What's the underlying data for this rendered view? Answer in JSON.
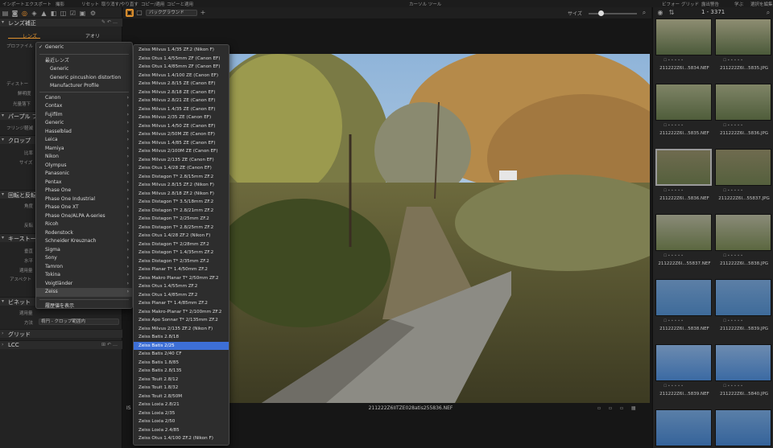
{
  "top_menu": [
    "インポート",
    "エクスポート",
    "撮影",
    "リセット",
    "取り消す/やり直す",
    "コピー/適用",
    "コピーと適用",
    "カーソル ツール",
    "ビフォー",
    "グリッド",
    "露出警告",
    "学ぶ",
    "選択を編集"
  ],
  "left_panel": {
    "lens_section_title": "レンズ補正",
    "tabs": [
      "レンズ",
      "アオリ"
    ],
    "rows": [
      "プロファイル",
      "ディストー",
      "鮮明度",
      "光量落下"
    ],
    "purple_section": "パープル フ",
    "fringe_row": "フリンジ軽減",
    "crop_section": "クロップ",
    "crop_rows": [
      "比率",
      "サイズ"
    ],
    "rotate_section": "回転と反転",
    "rotate_rows": [
      "角度",
      "反転"
    ],
    "keystone_section": "キーストー",
    "keystone_rows": [
      "垂直",
      "水平",
      "適用量",
      "アスペクト"
    ],
    "vignette_section": "ビネット",
    "vignette_rows": [
      "適用量",
      "方法"
    ],
    "vignette_method_value": "楕円 - クロップ範囲内",
    "grid_section": "グリッド",
    "lcc_section": "LCC"
  },
  "viewer": {
    "background_select": "バックグラウンド",
    "size_label": "サイズ",
    "filename": "211222Z6IITZE028atis255836.NEF",
    "left_fragment": "IS"
  },
  "browser": {
    "counter": "1 - 3371",
    "thumbnails": [
      {
        "name": "211222Z6I...5834.NEF"
      },
      {
        "name": "211222Z6I...5835.JPG"
      },
      {
        "name": "211222Z6I...5835.NEF"
      },
      {
        "name": "211222Z6I...5836.JPG"
      },
      {
        "name": "211222Z6I...5836.NEF"
      },
      {
        "name": "211222Z6I...55837.JPG"
      },
      {
        "name": "211222Z6I...55837.NEF"
      },
      {
        "name": "211222Z6I...5838.JPG"
      },
      {
        "name": "211222Z6I...5838.NEF"
      },
      {
        "name": "211222Z6I...5839.JPG"
      },
      {
        "name": "211222Z6I...5839.NEF"
      },
      {
        "name": "211222Z6I...5840.JPG"
      },
      {
        "name": ""
      },
      {
        "name": ""
      }
    ]
  },
  "menu1": {
    "checked": "Generic",
    "recent_header": "最近レンズ",
    "recent": [
      "Generic",
      "Generic pincushion distortion",
      "Manufacturer Profile"
    ],
    "brands": [
      "Canon",
      "Contax",
      "Fujifilm",
      "Generic",
      "Hasselblad",
      "Leica",
      "Mamiya",
      "Nikon",
      "Olympus",
      "Panasonic",
      "Pentax",
      "Phase One",
      "Phase One Industrial",
      "Phase One XT",
      "Phase One/ALPA A-series",
      "Ricoh",
      "Rodenstock",
      "Schneider Kreuznach",
      "Sigma",
      "Sony",
      "Tamron",
      "Tokina",
      "Voigtländer",
      "Zeiss"
    ],
    "highlighted": "Zeiss",
    "footer": "履歴値を表示"
  },
  "menu2": {
    "items": [
      "Zeiss Milvus 1.4/35 ZF.2 (Nikon F)",
      "Zeiss Otus 1.4/55mm ZF (Canon EF)",
      "Zeiss Otus 1.4/85mm ZF (Canon EF)",
      "Zeiss Milvus 1.4/100 ZE (Canon EF)",
      "Zeiss Milvus 2.8/15 ZE (Canon EF)",
      "Zeiss Milvus 2.8/18 ZE (Canon EF)",
      "Zeiss Milvus 2.8/21 ZE (Canon EF)",
      "Zeiss Milvus 1.4/35 ZE (Canon EF)",
      "Zeiss Milvus 2/35 ZE (Canon EF)",
      "Zeiss Milvus 1.4/50 ZE (Canon EF)",
      "Zeiss Milvus 2/50M ZE (Canon EF)",
      "Zeiss Milvus 1.4/85 ZE (Canon EF)",
      "Zeiss Milvus 2/100M ZE (Canon EF)",
      "Zeiss Milvus 2/135 ZE (Canon EF)",
      "Zeiss Otus 1.4/28 ZE (Canon EF)",
      "Zeiss Distagon T* 2.8/15mm ZF.2",
      "Zeiss Milvus 2.8/15 ZF.2 (Nikon F)",
      "Zeiss Milvus 2.8/18 ZF.2 (Nikon F)",
      "Zeiss Distagon T* 3.5/18mm ZF.2",
      "Zeiss Distagon T* 2.8/21mm ZF.2",
      "Zeiss Distagon T* 2/25mm ZF.2",
      "Zeiss Distagon T* 2.8/25mm ZF.2",
      "Zeiss Otus 1.4/28 ZF.2 (Nikon F)",
      "Zeiss Distagon T* 2/28mm ZF.2",
      "Zeiss Distagon T* 1.4/35mm ZF.2",
      "Zeiss Distagon T* 2/35mm ZF.2",
      "Zeiss Planar T* 1.4/50mm ZF.2",
      "Zeiss Makro Planar T* 2/50mm ZF.2",
      "Zeiss Otus 1.4/55mm ZF.2",
      "Zeiss Otus 1.4/85mm ZF.2",
      "Zeiss Planar T* 1.4/85mm ZF.2",
      "Zeiss Makro-Planar T* 2/100mm ZF.2",
      "Zeiss Apo Sonnar T* 2/135mm ZF.2",
      "Zeiss Milvus 2/135 ZF.2 (Nikon F)",
      "Zeiss Batis 2.8/18",
      "Zeiss Batis 2/25",
      "Zeiss Batis 2/40 CF",
      "Zeiss Batis 1.8/85",
      "Zeiss Batis 2.8/135",
      "Zeiss Touit 2.8/12",
      "Zeiss Touit 1.8/32",
      "Zeiss Touit 2.8/50M",
      "Zeiss Loxia 2.8/21",
      "Zeiss Loxia 2/35",
      "Zeiss Loxia 2/50",
      "Zeiss Loxia 2.4/85",
      "Zeiss Otus 1.4/100 ZF.2 (Nikon F)"
    ],
    "selected": "Zeiss Batis 2/25"
  },
  "colors": {
    "accent": "#e0922f",
    "selection": "#3d6fd6"
  }
}
